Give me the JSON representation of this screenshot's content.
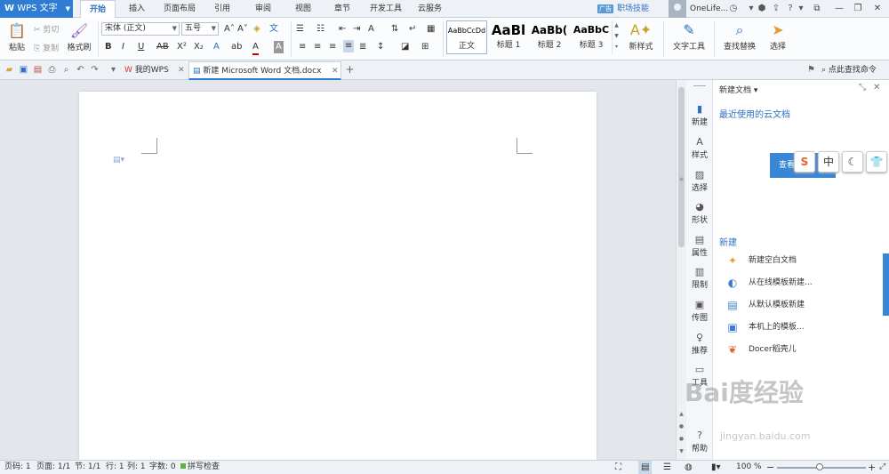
{
  "menubar": {
    "app_name": "WPS 文字",
    "items": [
      "开始",
      "插入",
      "页面布局",
      "引用",
      "审阅",
      "视图",
      "章节",
      "开发工具",
      "云服务"
    ],
    "ad_tag": "广告",
    "ad_text": "职场技能",
    "username": "OneLife..."
  },
  "ribbon": {
    "paste": "粘贴",
    "cut": "剪切",
    "copy": "复制",
    "format_painter": "格式刷",
    "font_name": "宋体 (正文)",
    "font_size": "五号",
    "styles": [
      {
        "sample": "AaBbCcDd",
        "name": "正文"
      },
      {
        "sample": "AaBl",
        "name": "标题 1"
      },
      {
        "sample": "AaBb(",
        "name": "标题 2"
      },
      {
        "sample": "AaBbC",
        "name": "标题 3"
      }
    ],
    "new_style": "新样式",
    "text_tools": "文字工具",
    "find_replace": "查找替换",
    "select": "选择"
  },
  "tabbar": {
    "tabs": [
      {
        "label": "我的WPS"
      },
      {
        "label": "新建 Microsoft Word 文档.docx"
      }
    ],
    "find_command": "点此查找命令"
  },
  "sidestrip": {
    "items": [
      "新建",
      "样式",
      "选择",
      "形状",
      "属性",
      "限制",
      "传图",
      "推荐",
      "工具",
      "帮助"
    ]
  },
  "taskpane": {
    "title": "新建文档",
    "cloud_link": "最近使用的云文档",
    "view_button": "查看",
    "section_new": "新建",
    "items": [
      "新建空白文档",
      "从在线模板新建...",
      "从默认模板新建",
      "本机上的模板...",
      "Docer稻壳儿"
    ]
  },
  "status": {
    "page_num": "页码: 1",
    "pages": "页面: 1/1",
    "section": "节: 1/1",
    "row": "行: 1",
    "col": "列: 1",
    "words": "字数: 0",
    "spell": "拼写检查",
    "zoom": "100 %"
  },
  "watermark": {
    "text": "Bai度经验",
    "url": "jingyan.baidu.com"
  }
}
